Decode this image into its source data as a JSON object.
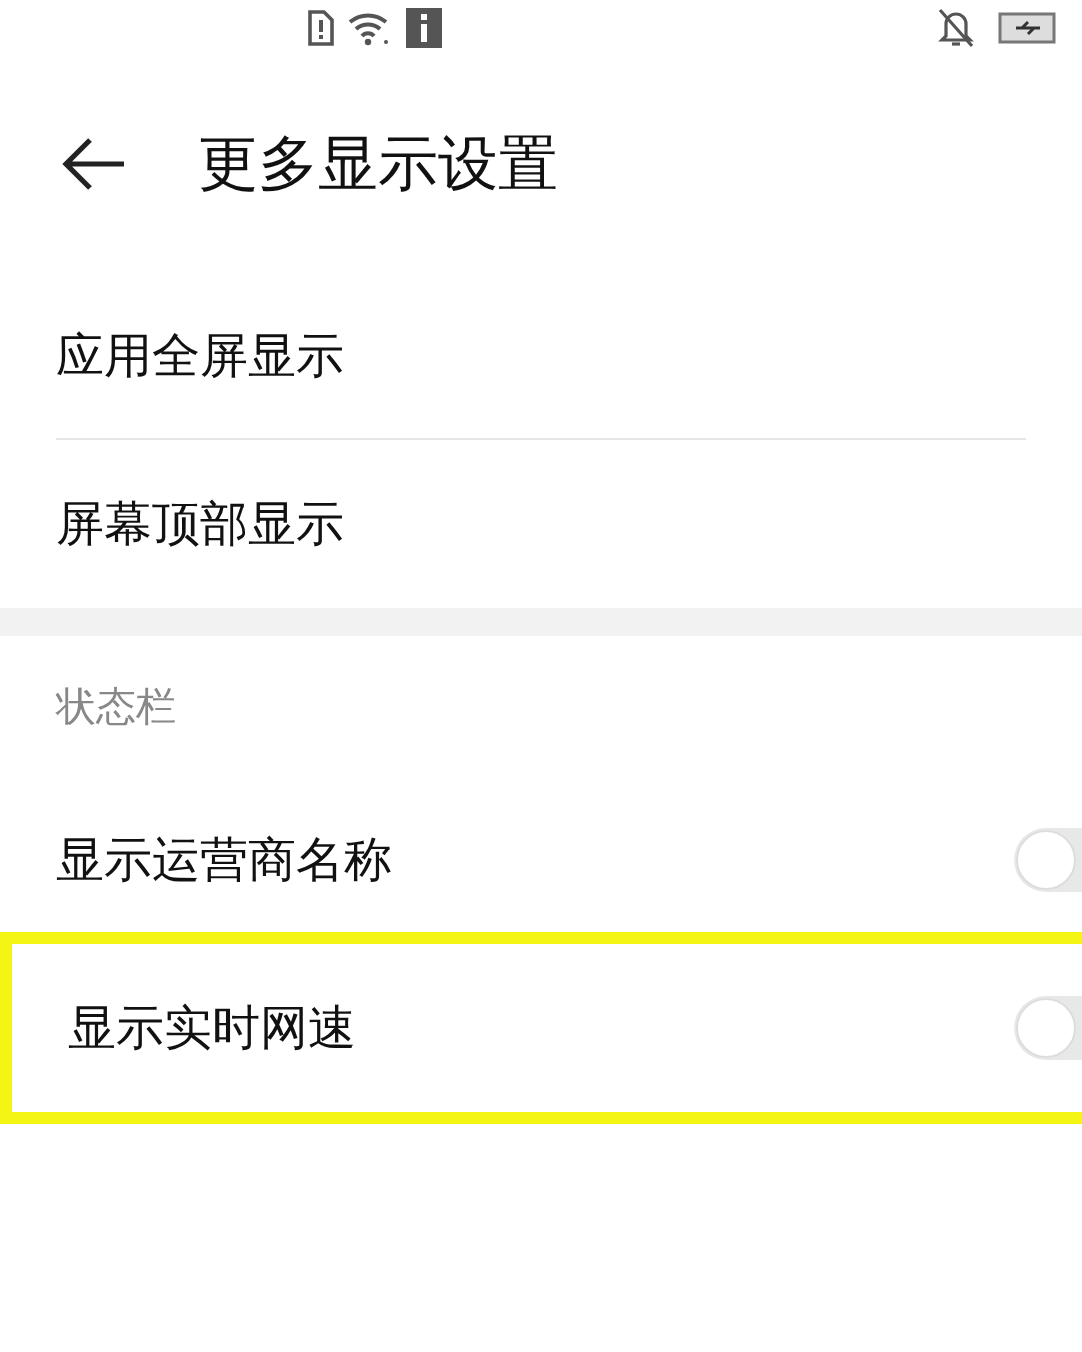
{
  "header": {
    "title": "更多显示设置"
  },
  "items": [
    {
      "label": "应用全屏显示"
    },
    {
      "label": "屏幕顶部显示"
    }
  ],
  "section": {
    "title": "状态栏",
    "items": [
      {
        "label": "显示运营商名称",
        "on": false,
        "highlighted": false
      },
      {
        "label": "显示实时网速",
        "on": false,
        "highlighted": true
      }
    ]
  }
}
